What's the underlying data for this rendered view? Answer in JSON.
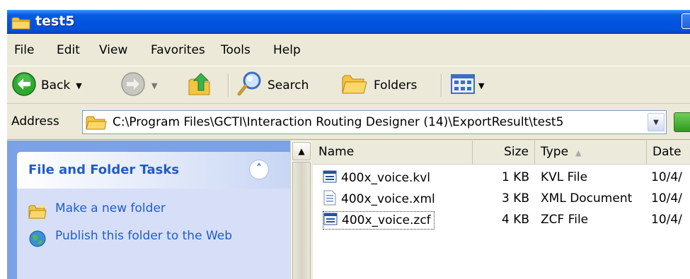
{
  "window": {
    "title": "test5"
  },
  "menu": {
    "file": "File",
    "edit": "Edit",
    "view": "View",
    "favorites": "Favorites",
    "tools": "Tools",
    "help": "Help"
  },
  "toolbar": {
    "back_label": "Back",
    "search_label": "Search",
    "folders_label": "Folders"
  },
  "address": {
    "label": "Address",
    "value": "C:\\Program Files\\GCTI\\Interaction Routing Designer (14)\\ExportResult\\test5"
  },
  "task_pane": {
    "header": "File and Folder Tasks",
    "tasks": [
      {
        "label": "Make a new folder",
        "icon": "new-folder-icon"
      },
      {
        "label": "Publish this folder to the Web",
        "icon": "publish-web-icon"
      }
    ]
  },
  "file_list": {
    "columns": {
      "name": "Name",
      "size": "Size",
      "type": "Type",
      "date": "Date"
    },
    "rows": [
      {
        "name": "400x_voice.kvl",
        "size": "1 KB",
        "type": "KVL File",
        "date": "10/4/",
        "icon": "file-window-icon"
      },
      {
        "name": "400x_voice.xml",
        "size": "3 KB",
        "type": "XML Document",
        "date": "10/4/",
        "icon": "xml-document-icon"
      },
      {
        "name": "400x_voice.zcf",
        "size": "4 KB",
        "type": "ZCF File",
        "date": "10/4/",
        "icon": "file-window-icon"
      }
    ]
  },
  "colors": {
    "titlebar": "#0053e1",
    "task_pane_bg": "#7ba2e7",
    "task_link": "#215dc6",
    "chrome": "#ece9d8"
  }
}
